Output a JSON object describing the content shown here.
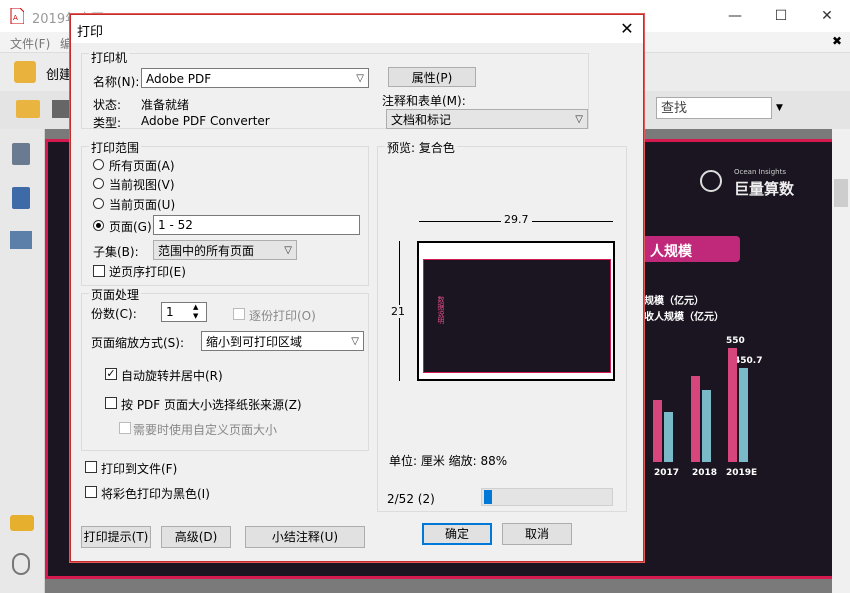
{
  "app": {
    "title": "2019年中国...(blurred)",
    "menu": [
      "文件(F)",
      "编"
    ],
    "create_label": "创建",
    "search_placeholder": "查找",
    "minimize": "—",
    "maximize": "☐",
    "close": "✕",
    "panel_close": "✖"
  },
  "slide": {
    "brand_en": "Ocean Insights",
    "brand_cn": "巨量算数",
    "banner": "人规模",
    "legend1": "规模（亿元）",
    "legend2": "收人规模（亿元）",
    "values": [
      "550",
      "450.7"
    ],
    "years": [
      "2017",
      "2018",
      "2019E"
    ]
  },
  "dialog": {
    "title": "打印",
    "close": "✕",
    "printer_group": "打印机",
    "name_label": "名称(N):",
    "name_value": "Adobe PDF",
    "properties_button": "属性(P)",
    "status_label": "状态:",
    "status_value": "准备就绪",
    "type_label": "类型:",
    "type_value": "Adobe PDF Converter",
    "comments_label": "注释和表单(M):",
    "comments_value": "文档和标记",
    "range_group": "打印范围",
    "range_all": "所有页面(A)",
    "range_view": "当前视图(V)",
    "range_current": "当前页面(U)",
    "range_pages": "页面(G)",
    "pages_value": "1 - 52",
    "subset_label": "子集(B):",
    "subset_value": "范围中的所有页面",
    "reverse_label": "逆页序打印(E)",
    "handling_group": "页面处理",
    "copies_label": "份数(C):",
    "copies_value": "1",
    "collate_label": "逐份打印(O)",
    "scaling_label": "页面缩放方式(S):",
    "scaling_value": "缩小到可打印区域",
    "auto_rotate_label": "自动旋转并居中(R)",
    "paper_source_label": "按 PDF 页面大小选择纸张来源(Z)",
    "custom_size_label": "需要时使用自定义页面大小",
    "print_to_file_label": "打印到文件(F)",
    "print_color_black_label": "将彩色打印为黑色(I)",
    "preview_label": "预览: 复合色",
    "width_dim": "29.7",
    "height_dim": "21",
    "preview_side_text": "数据说明",
    "unit_label": "单位: 厘米 缩放: 88%",
    "page_indicator": "2/52 (2)",
    "tips_button": "打印提示(T)",
    "advanced_button": "高级(D)",
    "summarize_button": "小结注释(U)",
    "ok_button": "确定",
    "cancel_button": "取消"
  },
  "colors": {
    "accent": "#d41a4f",
    "dialog_border": "#c42b2b",
    "focus": "#0078d7"
  }
}
